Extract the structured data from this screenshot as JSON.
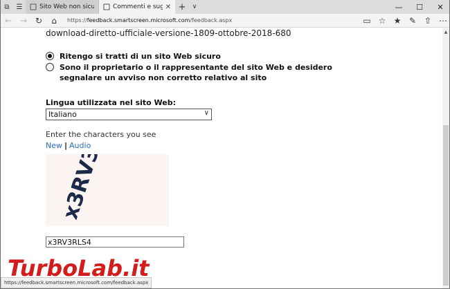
{
  "browser": {
    "tabs": [
      {
        "label": "Sito Web non sicuro segnal",
        "active": false
      },
      {
        "label": "Commenti e suggerime",
        "active": true
      }
    ],
    "address": {
      "scheme": "https://",
      "host": "feedback.smartscreen.microsoft.com",
      "path": "/feedback.aspx"
    }
  },
  "page": {
    "filename": "download-diretto-ufficiale-versione-1809-ottobre-2018-680",
    "radio_options": [
      {
        "label": "Ritengo si tratti di un sito Web sicuro",
        "selected": true
      },
      {
        "label_line1": "Sono il proprietario o il rappresentante del sito Web e desidero",
        "label_line2": "segnalare un avviso non corretto relativo al sito",
        "selected": false
      }
    ],
    "language_label": "Lingua utilizzata nel sito Web:",
    "language_value": "Italiano",
    "captcha_prompt": "Enter the characters you see",
    "captcha_new": "New",
    "captcha_sep": "|",
    "captcha_audio": "Audio",
    "captcha_value": "x3RV3RLS4",
    "captcha_chars": "x3RV3RLS4"
  },
  "status_url": "https://feedback.smartscreen.microsoft.com/feedback.aspx",
  "watermark": "TurboLab.it",
  "colors": {
    "link": "#2a6ebb",
    "watermark_red": "#d31c1c",
    "tab_active": "#f4f4f4"
  }
}
